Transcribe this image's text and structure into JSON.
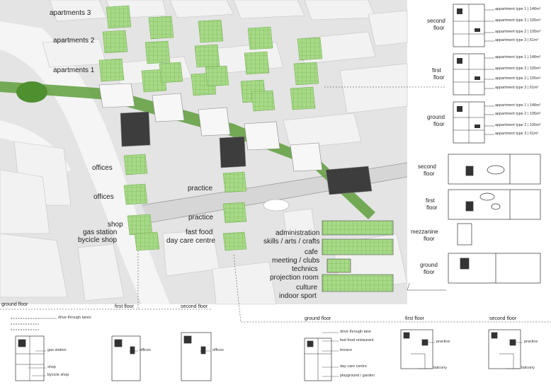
{
  "aerial_labels": {
    "apartments3": "apartments 3",
    "apartments2": "apartments 2",
    "apartments1": "apartments 1",
    "offices_upper": "offices",
    "offices_lower": "offices",
    "shop": "shop",
    "gas_station": "gas station",
    "bicycle_shop": "bycicle shop",
    "practice_upper": "practice",
    "practice_lower": "practice",
    "fast_food": "fast food",
    "day_care": "day care centre",
    "administration": "administration",
    "skills": "skills / arts / crafts",
    "cafe": "cafe",
    "meeting": "meeting / clubs",
    "technics": "technics",
    "projection": "projection room",
    "culture": "culture",
    "indoor_sport": "indoor sport"
  },
  "apartment_plans": {
    "floors": [
      {
        "label_1": "second",
        "label_2": "floor",
        "types": [
          "appartment type 1 | 148m²",
          "appartment type 2 | 105m²",
          "appartment type 2 | 105m²",
          "appartment type 3 | 61m²"
        ]
      },
      {
        "label_1": "first",
        "label_2": "floor",
        "types": [
          "appartment type 1 | 148m²",
          "appartment type 2 | 105m²",
          "appartment type 2 | 105m²",
          "appartment type 3 | 61m²"
        ]
      },
      {
        "label_1": "ground",
        "label_2": "floor",
        "types": [
          "appartment type 1 | 148m²",
          "appartment type 2 | 105m²",
          "appartment type 2 | 105m²",
          "appartment type 3 | 61m²"
        ]
      }
    ]
  },
  "community_plans": {
    "floors": [
      {
        "label_1": "second",
        "label_2": "floor"
      },
      {
        "label_1": "first",
        "label_2": "floor"
      },
      {
        "label_1": "mezzanine",
        "label_2": "floor"
      },
      {
        "label_1": "ground",
        "label_2": "floor"
      }
    ]
  },
  "bottom_left": {
    "headers": [
      "ground floor",
      "first floor",
      "second floor"
    ],
    "labels": {
      "drive_through": "drive through lanes",
      "gas_station": "gas station",
      "offices_1": "offices",
      "offices_2": "offices",
      "shop": "shop",
      "bicycle_shop": "bycicle shop"
    }
  },
  "bottom_right": {
    "headers": [
      "ground floor",
      "first floor",
      "second floor"
    ],
    "labels": {
      "drive_through": "drive through lane",
      "fast_food": "fast food restaurant",
      "terrace": "terrace",
      "day_care": "day care centre",
      "playground": "playground / garden",
      "practice_1": "practice",
      "practice_2": "practice",
      "balcony_1": "balcony",
      "balcony_2": "balcony"
    }
  },
  "colors": {
    "plan_green": "#a7d987",
    "plan_green_dark": "#6fae4c",
    "building_light": "#dcdcdc",
    "building_white": "#f4f4f4",
    "building_dark": "#3d3d3d",
    "ground": "#e9e9e9",
    "road": "#f7f7f7",
    "vegetation": "#4e8f2f"
  }
}
